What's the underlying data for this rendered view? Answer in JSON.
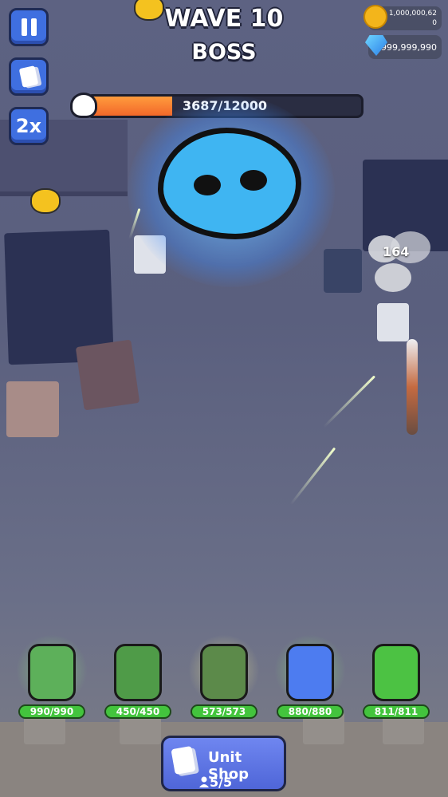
{
  "hud": {
    "speed_label": "2x"
  },
  "wave": {
    "title": "WAVE 10",
    "subtitle": "BOSS"
  },
  "currency": {
    "gold_line1": "1,000,000,62",
    "gold_line2": "0",
    "gems": "999,999,990"
  },
  "boss": {
    "hp_current": 3687,
    "hp_max": 12000,
    "hp_text": "3687/12000",
    "hp_fraction": 0.307
  },
  "effects": {
    "damage_number": "164"
  },
  "units": [
    {
      "name": "tank",
      "hp_text": "990/990",
      "hp_fraction": 1.0,
      "color": "#5db05a"
    },
    {
      "name": "bazooka-soldier",
      "hp_text": "450/450",
      "hp_fraction": 1.0,
      "color": "#4f9b48"
    },
    {
      "name": "camo-soldier",
      "hp_text": "573/573",
      "hp_fraction": 1.0,
      "color": "#5c8a4a"
    },
    {
      "name": "gumball-machine",
      "hp_text": "880/880",
      "hp_fraction": 1.0,
      "color": "#4d7cf0"
    },
    {
      "name": "green-dinosaur",
      "hp_text": "811/811",
      "hp_fraction": 1.0,
      "color": "#4cc243"
    }
  ],
  "shop": {
    "label": "Unit Shop",
    "count": "5/5"
  },
  "colors": {
    "hud_button": "#3f6fe0",
    "hp_fill": "#f2682a",
    "unit_hp": "#43c43d",
    "boss_body": "#3fb5f2"
  }
}
